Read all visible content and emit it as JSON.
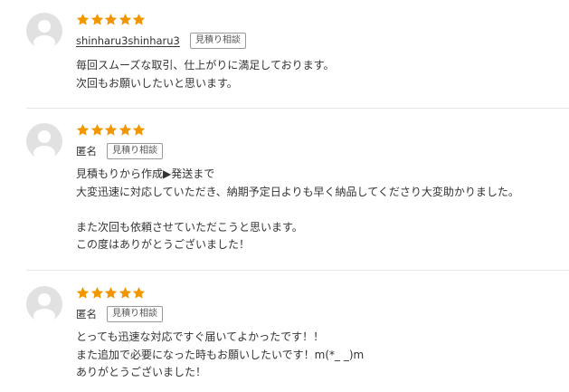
{
  "colors": {
    "star": "#f29600",
    "avatar_bg": "#e1e1e1",
    "avatar_fg": "#ffffff",
    "divider": "#e6e6e6"
  },
  "icons": {
    "star": "star-icon",
    "avatar": "user-avatar-icon"
  },
  "reviews": [
    {
      "rating": 5,
      "user": "shinharu3shinharu3",
      "tag": "見積り相談",
      "lines": [
        "毎回スムーズな取引、仕上がりに満足しております。",
        "次回もお願いしたいと思います。"
      ]
    },
    {
      "rating": 5,
      "user": "匿名",
      "tag": "見積り相談",
      "lines": [
        "見積もりから作成▶発送まで",
        "大変迅速に対応していただき、納期予定日よりも早く納品してくださり大変助かりました。",
        "",
        "また次回も依頼させていただこうと思います。",
        "この度はありがとうございました！"
      ]
    },
    {
      "rating": 5,
      "user": "匿名",
      "tag": "見積り相談",
      "lines": [
        "とっても迅速な対応ですぐ届いてよかったです！！",
        "また追加で必要になった時もお願いしたいです！m(*_ _)m",
        "ありがとうございました！"
      ]
    }
  ]
}
